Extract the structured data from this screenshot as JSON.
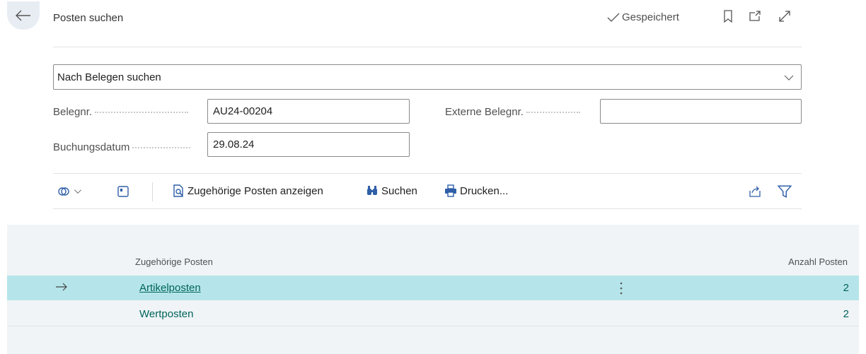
{
  "header": {
    "title": "Posten suchen",
    "saved_label": "Gespeichert",
    "icons": [
      "back-arrow-icon",
      "bookmark-icon",
      "open-new-window-icon",
      "expand-icon"
    ]
  },
  "search_mode": {
    "selected": "Nach Belegen suchen"
  },
  "fields": {
    "document_no": {
      "label": "Belegnr.",
      "value": "AU24-00204"
    },
    "posting_date": {
      "label": "Buchungsdatum",
      "value": "29.08.24"
    },
    "external_document_no": {
      "label": "Externe Belegnr.",
      "value": ""
    }
  },
  "toolbar": {
    "show_related_label": "Zugehörige Posten anzeigen",
    "search_label": "Suchen",
    "print_label": "Drucken..."
  },
  "table": {
    "columns": {
      "name": "Zugehörige Posten",
      "count": "Anzahl Posten"
    },
    "rows": [
      {
        "name": "Artikelposten",
        "count": "2",
        "selected": true
      },
      {
        "name": "Wertposten",
        "count": "2",
        "selected": false
      }
    ]
  },
  "colors": {
    "accent": "#00645a",
    "selected_row": "#b5e5ea",
    "list_bg": "#f0f4f7"
  }
}
